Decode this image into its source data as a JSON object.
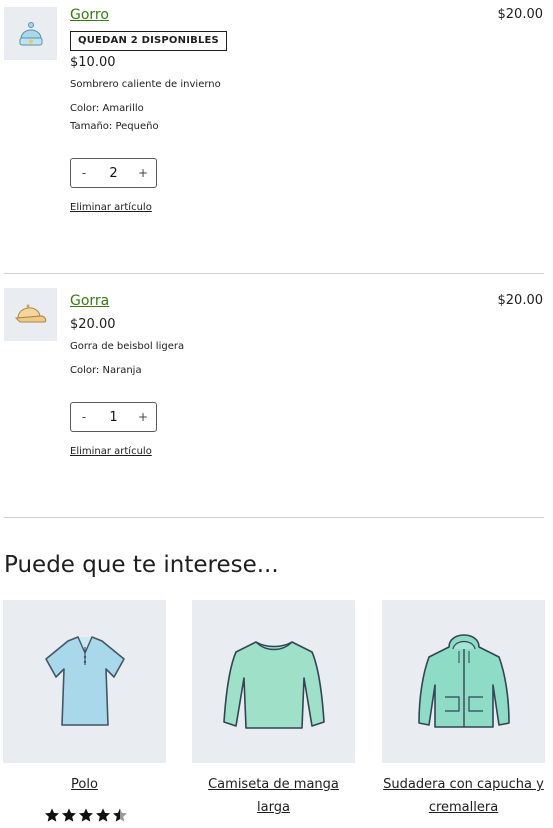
{
  "cart_items": [
    {
      "name": "Gorro",
      "badge": "QUEDAN 2 DISPONIBLES",
      "price": "$10.00",
      "total": "$20.00",
      "description": "Sombrero caliente de invierno",
      "attributes": [
        "Color: Amarillo",
        "Tamaño: Pequeño"
      ],
      "quantity": "2",
      "decrement": "-",
      "increment": "+",
      "remove_label": "Eliminar artículo"
    },
    {
      "name": "Gorra",
      "price": "$20.00",
      "total": "$20.00",
      "description": "Gorra de beisbol ligera",
      "attributes": [
        "Color: Naranja"
      ],
      "quantity": "1",
      "decrement": "-",
      "increment": "+",
      "remove_label": "Eliminar artículo"
    }
  ],
  "recommendations": {
    "title": "Puede que te interese...",
    "products": [
      {
        "name": "Polo",
        "icon": "polo-shirt-icon",
        "rating": 4.5
      },
      {
        "name": "Camiseta de manga larga",
        "icon": "long-sleeve-shirt-icon"
      },
      {
        "name": "Sudadera con capucha y cremallera",
        "icon": "zip-hoodie-icon"
      }
    ]
  },
  "colors": {
    "link_green": "#3a7a16",
    "thumb_bg": "#e9edf1",
    "shirt_blue": "#a8d8ea",
    "shirt_mint": "#8fdcc6"
  }
}
